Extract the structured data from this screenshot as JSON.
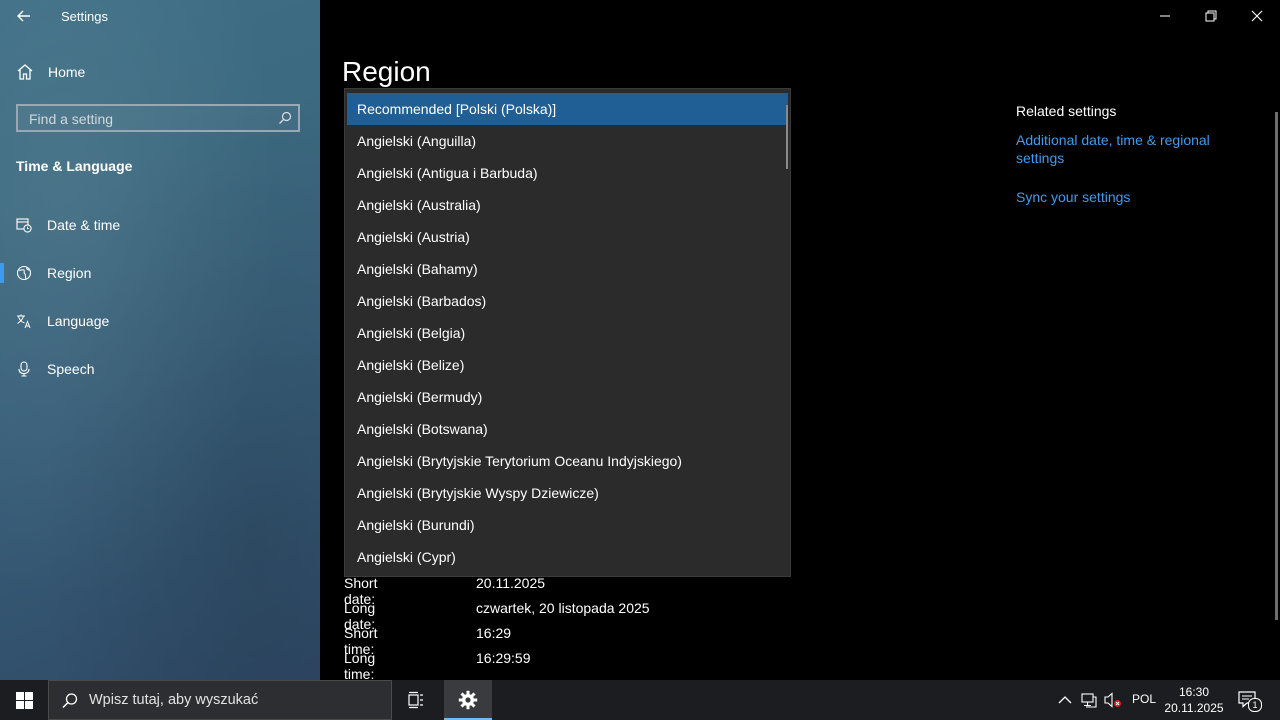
{
  "window": {
    "app_title": "Settings"
  },
  "sidebar": {
    "home_label": "Home",
    "search_placeholder": "Find a setting",
    "section_title": "Time & Language",
    "items": [
      {
        "label": "Date & time",
        "icon": "calendar-clock-icon"
      },
      {
        "label": "Region",
        "icon": "globe-icon",
        "active": true
      },
      {
        "label": "Language",
        "icon": "language-icon"
      },
      {
        "label": "Speech",
        "icon": "microphone-icon"
      }
    ]
  },
  "main": {
    "page_title": "Region",
    "related": {
      "title": "Related settings",
      "links": [
        {
          "label": "Additional date, time & regional settings"
        },
        {
          "label": "Sync your settings"
        }
      ]
    },
    "dropdown": {
      "options": [
        "Recommended [Polski (Polska)]",
        "Angielski (Anguilla)",
        "Angielski (Antigua i Barbuda)",
        "Angielski (Australia)",
        "Angielski (Austria)",
        "Angielski (Bahamy)",
        "Angielski (Barbados)",
        "Angielski (Belgia)",
        "Angielski (Belize)",
        "Angielski (Bermudy)",
        "Angielski (Botswana)",
        "Angielski (Brytyjskie Terytorium Oceanu Indyjskiego)",
        "Angielski (Brytyjskie Wyspy Dziewicze)",
        "Angielski (Burundi)",
        "Angielski (Cypr)"
      ],
      "selected_index": 0
    },
    "formats": [
      {
        "key": "Short date:",
        "value": "20.11.2025"
      },
      {
        "key": "Long date:",
        "value": "czwartek, 20 listopada 2025"
      },
      {
        "key": "Short time:",
        "value": "16:29"
      },
      {
        "key": "Long time:",
        "value": "16:29:59"
      }
    ]
  },
  "taskbar": {
    "search_placeholder": "Wpisz tutaj, aby wyszukać",
    "language": "POL",
    "time": "16:30",
    "date": "20.11.2025",
    "notification_count": "1"
  },
  "colors": {
    "accent": "#3a9cf0",
    "link": "#3d9cf0",
    "selection": "#1f5f95",
    "dropdown_bg": "#2b2b2b",
    "taskbar_bg": "#1c1d20"
  }
}
